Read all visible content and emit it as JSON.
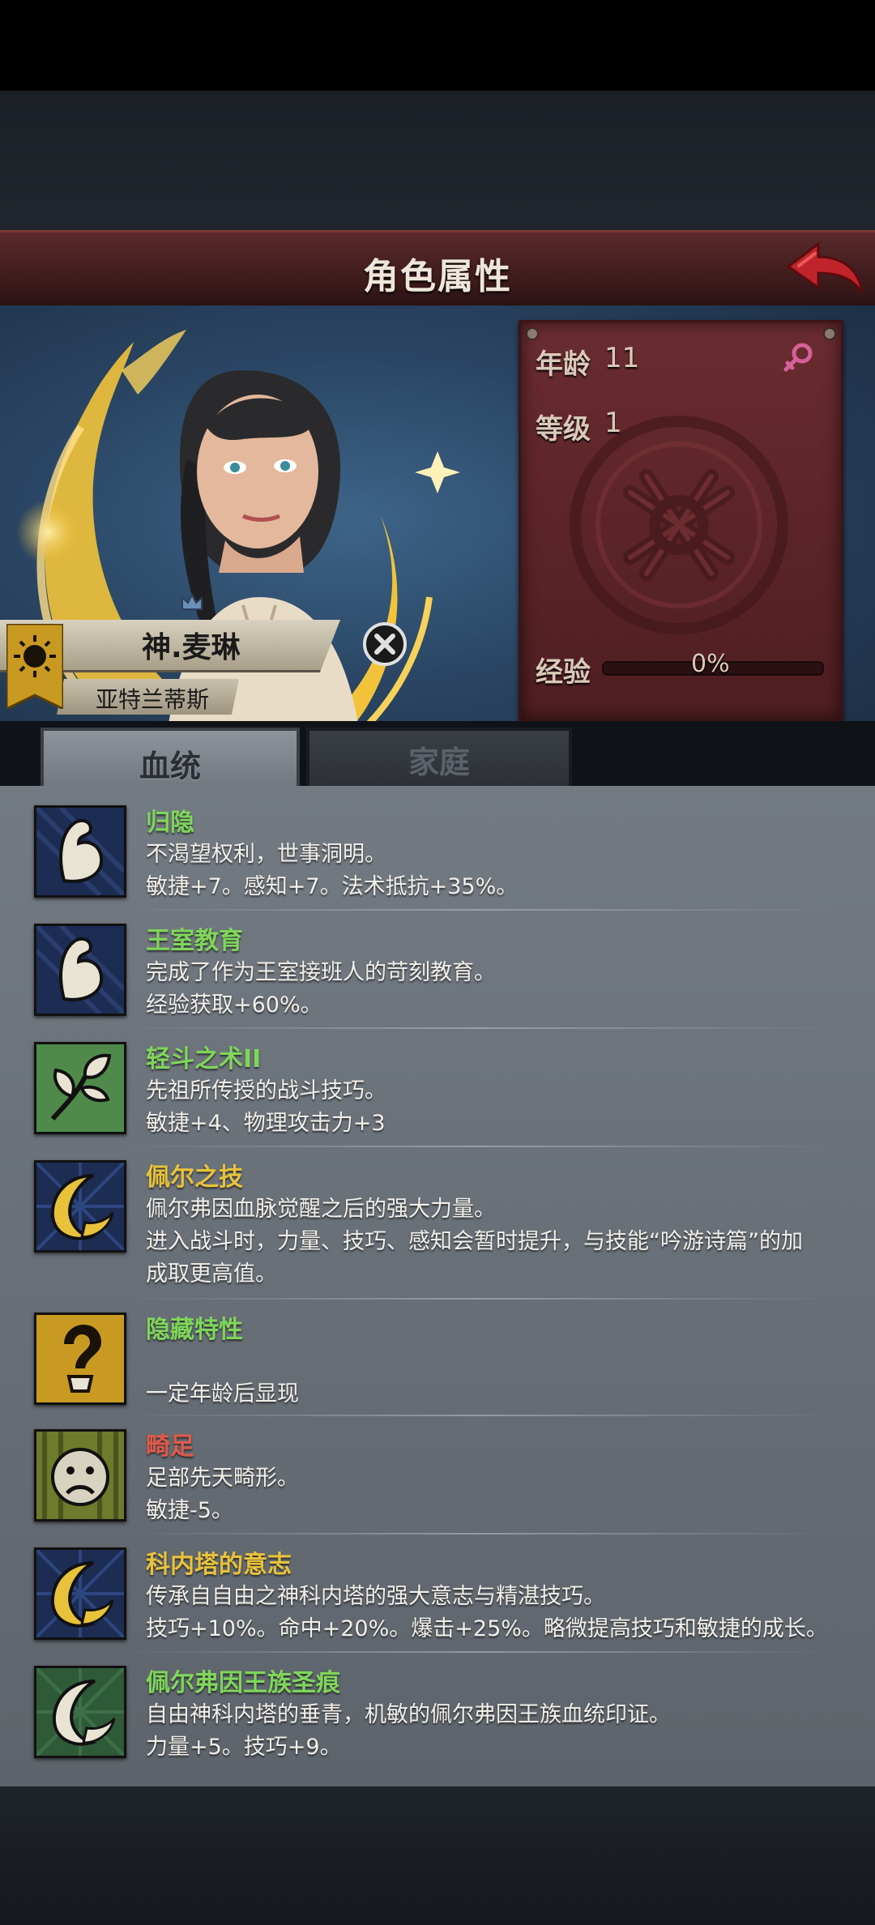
{
  "header": {
    "title": "角色属性",
    "back_icon": "back-arrow-icon"
  },
  "character": {
    "name": "神.麦琳",
    "house": "亚特兰蒂斯",
    "close_icon": "close-icon",
    "crest_icon": "sun-crest-icon"
  },
  "stats": {
    "age_label": "年龄",
    "age_value": "11",
    "gender_icon": "female-symbol-icon",
    "level_label": "等级",
    "level_value": "1",
    "exp_label": "经验",
    "exp_value": "0%",
    "exp_progress": 0
  },
  "tabs": [
    {
      "label": "血统",
      "active": true
    },
    {
      "label": "家庭",
      "active": false
    }
  ],
  "traits": [
    {
      "name": "归隐",
      "name_color": "#7fd65a",
      "icon": "flexed-arm-icon",
      "lines": [
        "不渴望权利，世事洞明。",
        "敏捷+7。感知+7。法术抵抗+35%。"
      ]
    },
    {
      "name": "王室教育",
      "name_color": "#7fd65a",
      "icon": "flexed-arm-icon",
      "lines": [
        "完成了作为王室接班人的苛刻教育。",
        "经验获取+60%。"
      ]
    },
    {
      "name": "轻斗之术II",
      "name_color": "#7fd65a",
      "icon": "sprout-icon",
      "lines": [
        "先祖所传授的战斗技巧。",
        "敏捷+4、物理攻击力+3"
      ]
    },
    {
      "name": "佩尔之技",
      "name_color": "#e8c23a",
      "icon": "crescent-moon-icon",
      "lines": [
        "佩尔弗因血脉觉醒之后的强大力量。",
        "进入战斗时，力量、技巧、感知会暂时提升，与技能“吟游诗篇”的加",
        "成取更高值。"
      ]
    },
    {
      "name": "隐藏特性",
      "name_color": "#7fd65a",
      "icon": "question-mark-icon",
      "lines": [
        "",
        "一定年龄后显现"
      ]
    },
    {
      "name": "畸足",
      "name_color": "#e05a4a",
      "icon": "sad-face-icon",
      "lines": [
        "足部先天畸形。",
        "敏捷-5。"
      ]
    },
    {
      "name": "科内塔的意志",
      "name_color": "#e8c23a",
      "icon": "crescent-moon-icon",
      "lines": [
        "传承自自由之神科内塔的强大意志与精湛技巧。",
        "技巧+10%。命中+20%。爆击+25%。略微提高技巧和敏捷的成长。"
      ]
    },
    {
      "name": "佩尔弗因王族圣痕",
      "name_color": "#7fd65a",
      "icon": "feather-crescent-icon",
      "lines": [
        "自由神科内塔的垂青，机敏的佩尔弗因王族血统印证。",
        "力量+5。技巧+9。"
      ]
    }
  ]
}
